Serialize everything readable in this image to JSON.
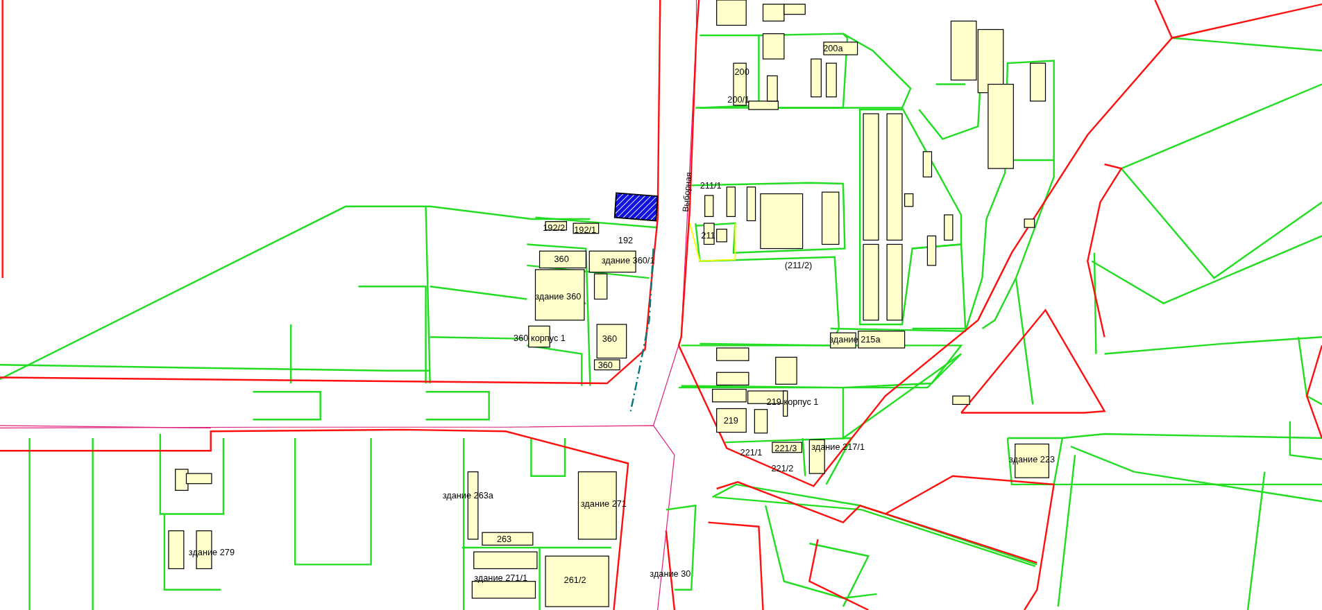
{
  "map": {
    "street_label": "Выборная",
    "labels": [
      "200а",
      "200",
      "200/1",
      "211/1",
      "192/2",
      "192/1",
      "211",
      "192",
      "360",
      "здание 360/1",
      "(211/2)",
      "здание 360",
      "360 корпус 1",
      "360",
      "здание 215а",
      "360",
      "219 корпус 1",
      "219",
      "221/1",
      "221/3",
      "здание 217/1",
      "221/2",
      "здание 223",
      "здание 263а",
      "здание 271",
      "263",
      "здание 279",
      "здание 271/1",
      "261/2",
      "здание 30"
    ]
  }
}
